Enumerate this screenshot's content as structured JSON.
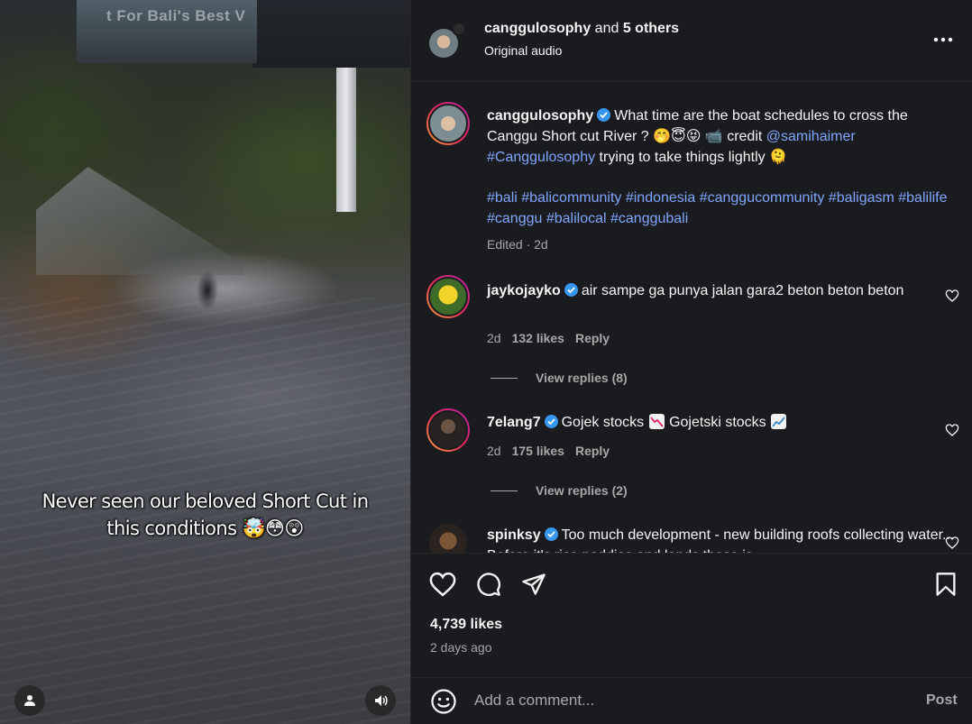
{
  "video": {
    "billboard_text": "t For Bali's Best V",
    "caption_line1": "Never seen our beloved Short Cut in",
    "caption_line2": "this conditions 🤯😳😲",
    "user_icon": "user-icon",
    "sound_icon": "speaker-icon"
  },
  "header": {
    "username": "canggulosophy",
    "and_text": " and ",
    "others": "5 others",
    "subtitle": "Original audio",
    "more_icon": "more-icon"
  },
  "post": {
    "username": "canggulosophy",
    "text_a": "What time are the boat schedules to cross the Canggu Short cut River ? 🤭😇😝 📹 credit ",
    "mention": "@samihaimer",
    "hashtag": "#Canggulosophy",
    "text_b": " trying to take things lightly 🫠",
    "hashtags": "#bali #balicommunity #indonesia #canggucommunity #baligasm #balilife #canggu #balilocal #canggubali",
    "meta": "Edited · 2d"
  },
  "comments": [
    {
      "username": "jaykojayko",
      "text": "air sampe ga punya jalan gara2 beton beton beton",
      "age": "2d",
      "likes": "132 likes",
      "reply": "Reply",
      "view_replies": "View replies (8)"
    },
    {
      "username": "7elang7",
      "text_a": "Gojek stocks ",
      "text_b": " Gojetski stocks ",
      "age": "2d",
      "likes": "175 likes",
      "reply": "Reply",
      "view_replies": "View replies (2)"
    },
    {
      "username": "spinksy",
      "text": "Too much development - new building roofs collecting water... Before it's rice paddies and lands those is"
    }
  ],
  "actions": {
    "likes": "4,739 likes",
    "ago": "2 days ago"
  },
  "comment_bar": {
    "placeholder": "Add a comment...",
    "post_label": "Post"
  },
  "colors": {
    "link": "#7fa6ff",
    "verified": "#3797f0",
    "panel_bg": "#1a1b1e",
    "muted": "#a8a8a8"
  }
}
